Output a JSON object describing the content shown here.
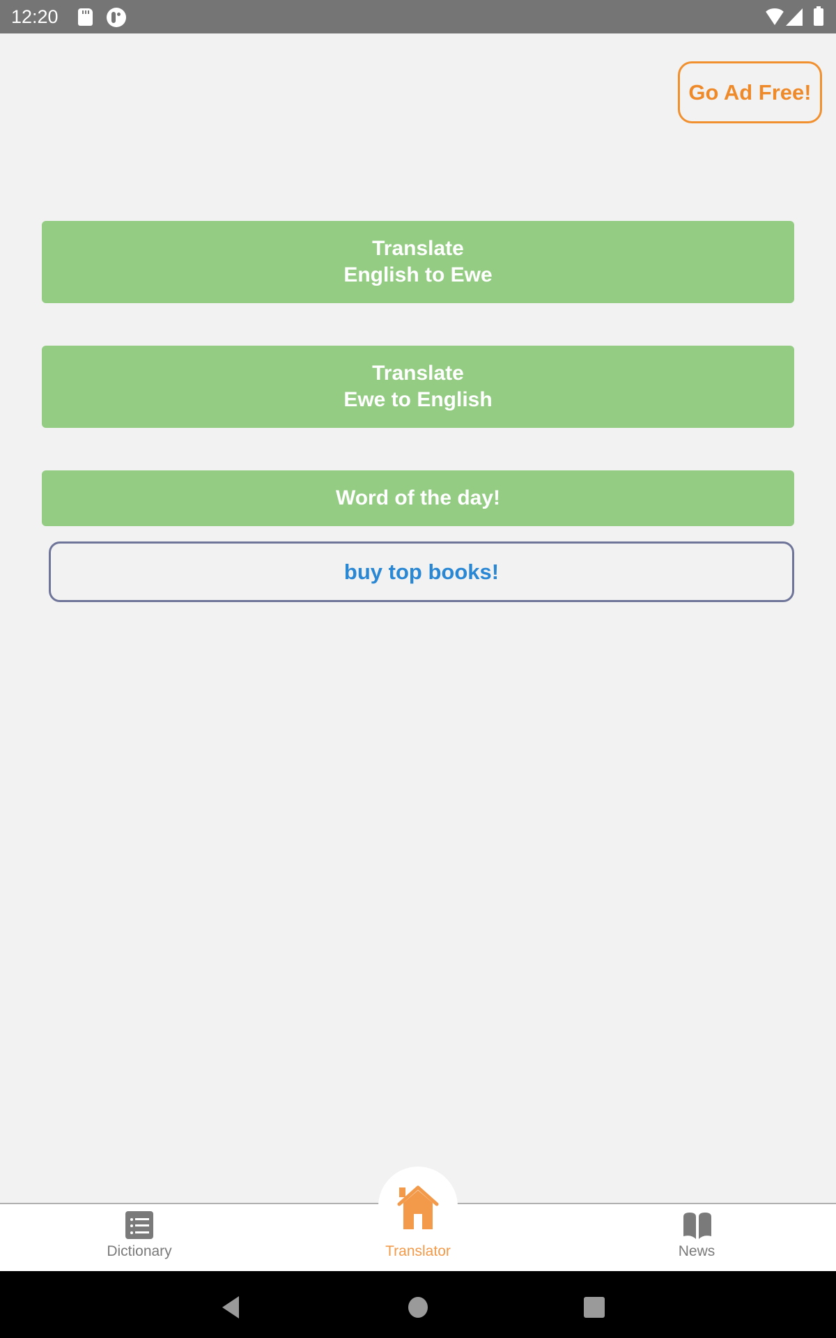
{
  "status_bar": {
    "time": "12:20",
    "icons": [
      "sd-card-icon",
      "app-notification-icon",
      "wifi-icon",
      "cell-signal-icon",
      "battery-icon"
    ]
  },
  "header": {
    "ad_free_label": "Go Ad Free!"
  },
  "main": {
    "buttons": [
      {
        "line1": "Translate",
        "line2": "English to Ewe"
      },
      {
        "line1": "Translate",
        "line2": "Ewe to English"
      },
      {
        "label": "Word of the day!"
      }
    ],
    "books_label": "buy top books!"
  },
  "bottom_nav": {
    "items": [
      {
        "label": "Dictionary",
        "icon": "list-icon",
        "active": false
      },
      {
        "label": "Translator",
        "icon": "home-icon",
        "active": true
      },
      {
        "label": "News",
        "icon": "book-icon",
        "active": false
      }
    ]
  },
  "colors": {
    "accent_orange": "#ef8a2a",
    "button_green": "#94cc84",
    "link_blue": "#2987d4",
    "outline_purple": "#6f7599",
    "inactive_gray": "#7a7a7a"
  }
}
